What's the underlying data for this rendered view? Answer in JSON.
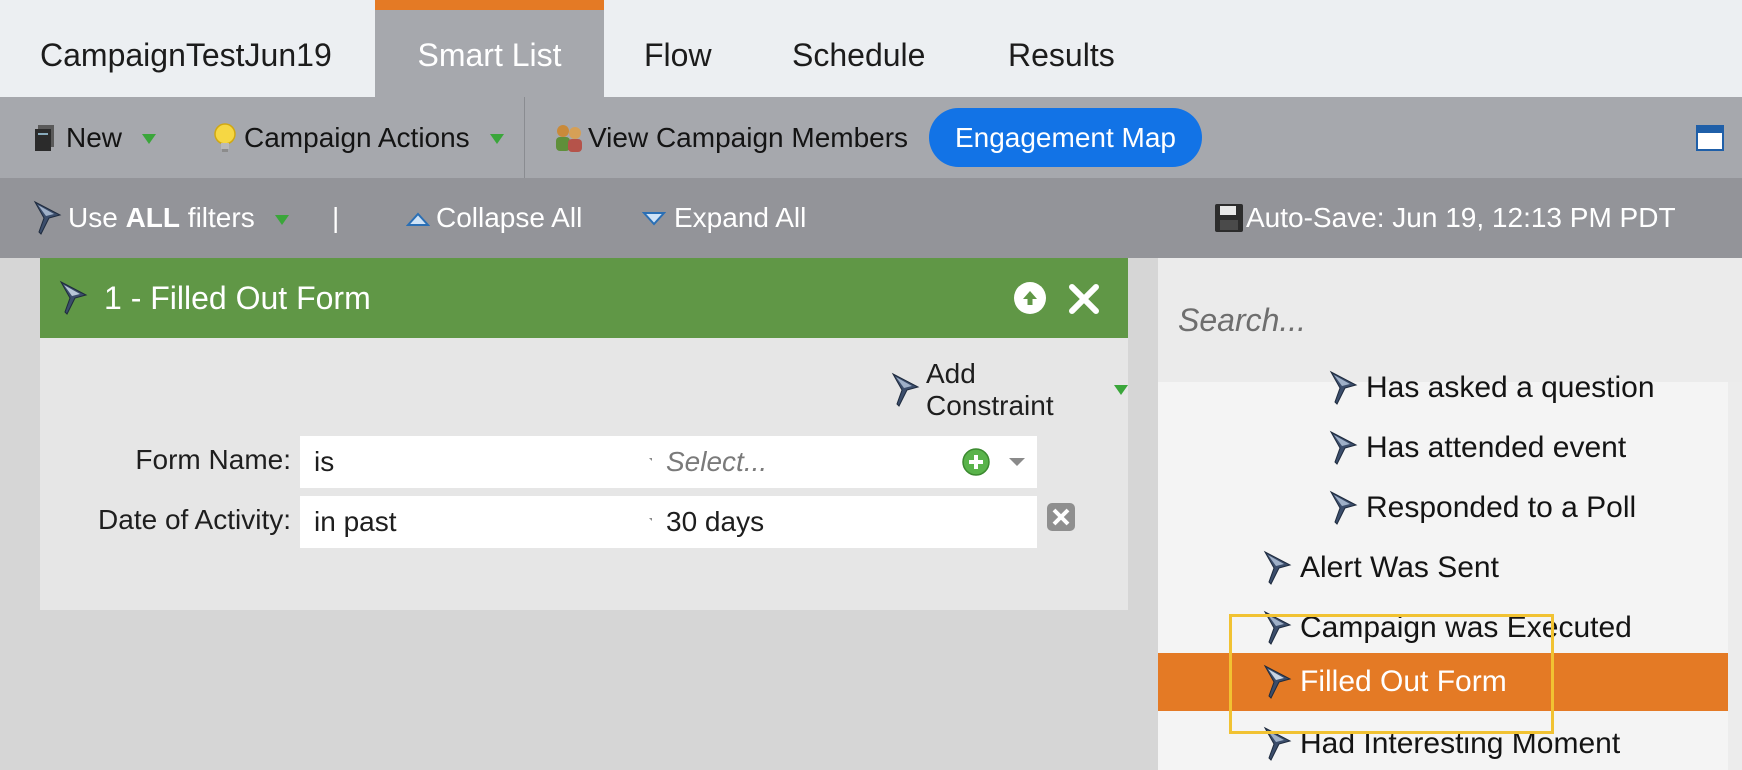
{
  "tabs": {
    "campaign": "CampaignTestJun19",
    "smart_list": "Smart List",
    "flow": "Flow",
    "schedule": "Schedule",
    "results": "Results"
  },
  "toolbar": {
    "new_label": "New",
    "campaign_actions_label": "Campaign Actions",
    "view_members_label": "View Campaign Members",
    "engagement_map_label": "Engagement Map"
  },
  "filterbar": {
    "use_prefix": "Use",
    "use_all": "ALL",
    "use_suffix": "filters",
    "separator": "|",
    "collapse_all": "Collapse All",
    "expand_all": "Expand All",
    "autosave": "Auto-Save: Jun 19, 12:13 PM PDT"
  },
  "filter": {
    "title": "1 - Filled Out Form",
    "add_constraint": "Add Constraint",
    "rows": [
      {
        "label": "Form Name:",
        "operator": "is",
        "value_placeholder": "Select..."
      },
      {
        "label": "Date of Activity:",
        "operator": "in past",
        "value": "30 days"
      }
    ]
  },
  "panel": {
    "search_placeholder": "Search...",
    "items": [
      "Has asked a question",
      "Has attended event",
      "Responded to a Poll",
      "Alert Was Sent",
      "Campaign was Executed",
      "Filled Out Form",
      "Had Interesting Moment"
    ],
    "selected": "Filled Out Form"
  },
  "colors": {
    "accent_orange": "#e47a25",
    "filter_green": "#609746",
    "engagement_blue": "#1273e6",
    "highlight_yellow": "#f1c232"
  }
}
